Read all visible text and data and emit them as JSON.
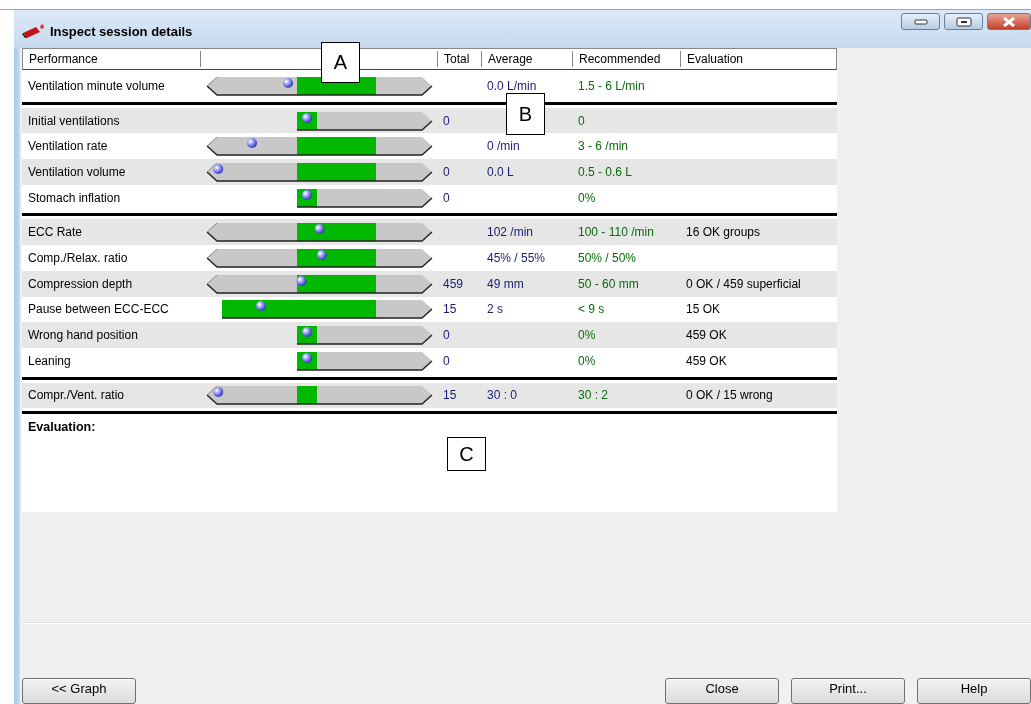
{
  "window": {
    "title": "Inspect session details"
  },
  "table": {
    "columns": [
      "Performance",
      "Total",
      "Average",
      "Recommended",
      "Evaluation"
    ],
    "groups": [
      {
        "rows": [
          {
            "label": "Ventilation minute volume",
            "gauge": {
              "kind": "range",
              "level": 0.36
            },
            "average": "0.0 L/min",
            "recommended": "1.5 - 6 L/min"
          }
        ]
      },
      {
        "rows": [
          {
            "label": "Initial ventilations",
            "gauge": {
              "kind": "zero"
            },
            "total": "0",
            "recommended": "0"
          },
          {
            "label": "Ventilation rate",
            "gauge": {
              "kind": "range",
              "level": 0.2
            },
            "average": "0 /min",
            "recommended": "3 - 6 /min"
          },
          {
            "label": "Ventilation volume",
            "gauge": {
              "kind": "range",
              "level": 0.05
            },
            "total": "0",
            "average": "0.0 L",
            "recommended": "0.5 - 0.6 L"
          },
          {
            "label": "Stomach inflation",
            "gauge": {
              "kind": "zero"
            },
            "total": "0",
            "recommended": "0%"
          }
        ]
      },
      {
        "rows": [
          {
            "label": "ECC Rate",
            "gauge": {
              "kind": "range",
              "level": 0.5
            },
            "average": "102 /min",
            "recommended": "100 - 110 /min",
            "evaluation": "16 OK groups"
          },
          {
            "label": "Comp./Relax. ratio",
            "gauge": {
              "kind": "range",
              "level": 0.51
            },
            "average": "45% / 55%",
            "recommended": "50% / 50%"
          },
          {
            "label": "Compression depth",
            "gauge": {
              "kind": "range",
              "level": 0.42
            },
            "total": "459",
            "average": "49 mm",
            "recommended": "50 - 60 mm",
            "evaluation": "0 OK / 459 superficial"
          },
          {
            "label": "Pause between ECC-ECC",
            "gauge": {
              "kind": "upper-limit",
              "level": 0.24
            },
            "total": "15",
            "average": "2 s",
            "recommended": "< 9 s",
            "evaluation": "15 OK"
          },
          {
            "label": "Wrong hand position",
            "gauge": {
              "kind": "zero"
            },
            "total": "0",
            "recommended": "0%",
            "evaluation": "459 OK"
          },
          {
            "label": "Leaning",
            "gauge": {
              "kind": "zero"
            },
            "total": "0",
            "recommended": "0%",
            "evaluation": "459 OK"
          }
        ]
      },
      {
        "rows": [
          {
            "label": "Compr./Vent. ratio",
            "gauge": {
              "kind": "target",
              "level": 0.05
            },
            "total": "15",
            "average": "30 : 0",
            "recommended": "30 : 2",
            "evaluation": "0 OK / 15 wrong"
          }
        ]
      }
    ]
  },
  "evaluation": {
    "heading": "Evaluation:"
  },
  "buttons": {
    "left": [
      "<< Graph"
    ],
    "right": [
      "Close",
      "Print...",
      "Help"
    ]
  },
  "callouts": [
    "A",
    "B",
    "C"
  ]
}
